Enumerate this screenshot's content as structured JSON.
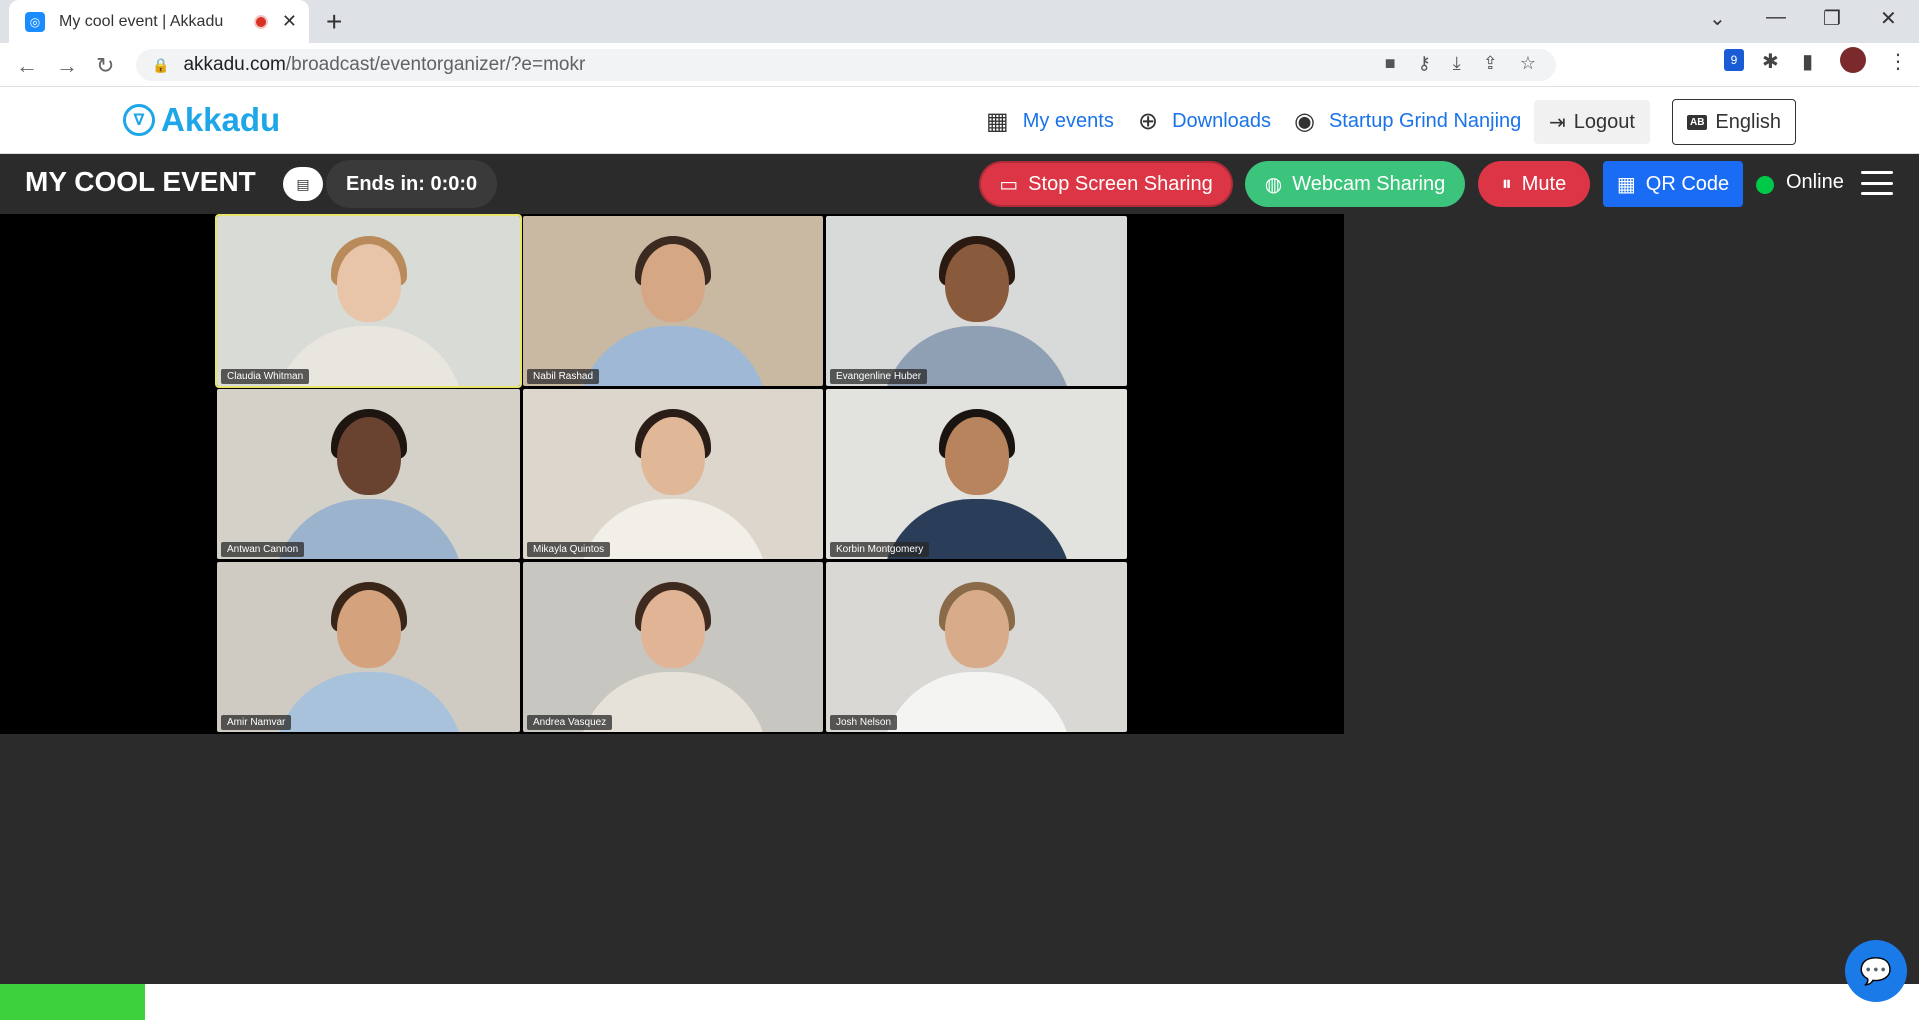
{
  "browser": {
    "tab_title": "My cool event | Akkadu",
    "url_host": "akkadu.com",
    "url_path": "/broadcast/eventorganizer/?e=mokr",
    "extension_badge": "9"
  },
  "site": {
    "brand": "Akkadu",
    "nav": {
      "my_events": "My events",
      "downloads": "Downloads",
      "organization": "Startup Grind Nanjing",
      "logout": "Logout",
      "language": "English",
      "language_icon": "AB"
    }
  },
  "event": {
    "title": "MY COOL EVENT",
    "ends_in": "Ends in: 0:0:0",
    "stop_screen_sharing": "Stop Screen Sharing",
    "webcam_sharing": "Webcam Sharing",
    "mute": "Mute",
    "qr_code": "QR Code",
    "status": "Online",
    "status_color": "#00c94a"
  },
  "participants": [
    {
      "name": "Claudia Whitman",
      "bg": "#d9dcd6",
      "skin": "#e8c4a8",
      "hair": "#b98a5a",
      "shirt": "#e9e6df",
      "active": true
    },
    {
      "name": "Nabil Rashad",
      "bg": "#c9b9a2",
      "skin": "#d6a784",
      "hair": "#3a2a20",
      "shirt": "#9fb8d6",
      "active": false
    },
    {
      "name": "Evangenline Huber",
      "bg": "#d8d9d9",
      "skin": "#8a5a3c",
      "hair": "#2a1a12",
      "shirt": "#8fa0b4",
      "active": false
    },
    {
      "name": "Antwan Cannon",
      "bg": "#d4d1c8",
      "skin": "#6a4330",
      "hair": "#1e1410",
      "shirt": "#9bb3cc",
      "active": false
    },
    {
      "name": "Mikayla Quintos",
      "bg": "#dcd6cc",
      "skin": "#e0b898",
      "hair": "#2a1c16",
      "shirt": "#f2efe9",
      "active": false
    },
    {
      "name": "Korbin Montgomery",
      "bg": "#e2e2de",
      "skin": "#b8845e",
      "hair": "#1a1410",
      "shirt": "#2a3e5a",
      "active": false
    },
    {
      "name": "Amir Namvar",
      "bg": "#cfcbc2",
      "skin": "#d4a27c",
      "hair": "#3a2618",
      "shirt": "#a8c2dc",
      "active": false
    },
    {
      "name": "Andrea Vasquez",
      "bg": "#c8c6c0",
      "skin": "#e0b494",
      "hair": "#3e2a1e",
      "shirt": "#e6e2da",
      "active": false
    },
    {
      "name": "Josh Nelson",
      "bg": "#d9d8d4",
      "skin": "#d8ac8a",
      "hair": "#8a6a48",
      "shirt": "#f4f4f2",
      "active": false
    }
  ],
  "progress": {
    "fraction": 0.0755,
    "color": "#3dd13d"
  }
}
